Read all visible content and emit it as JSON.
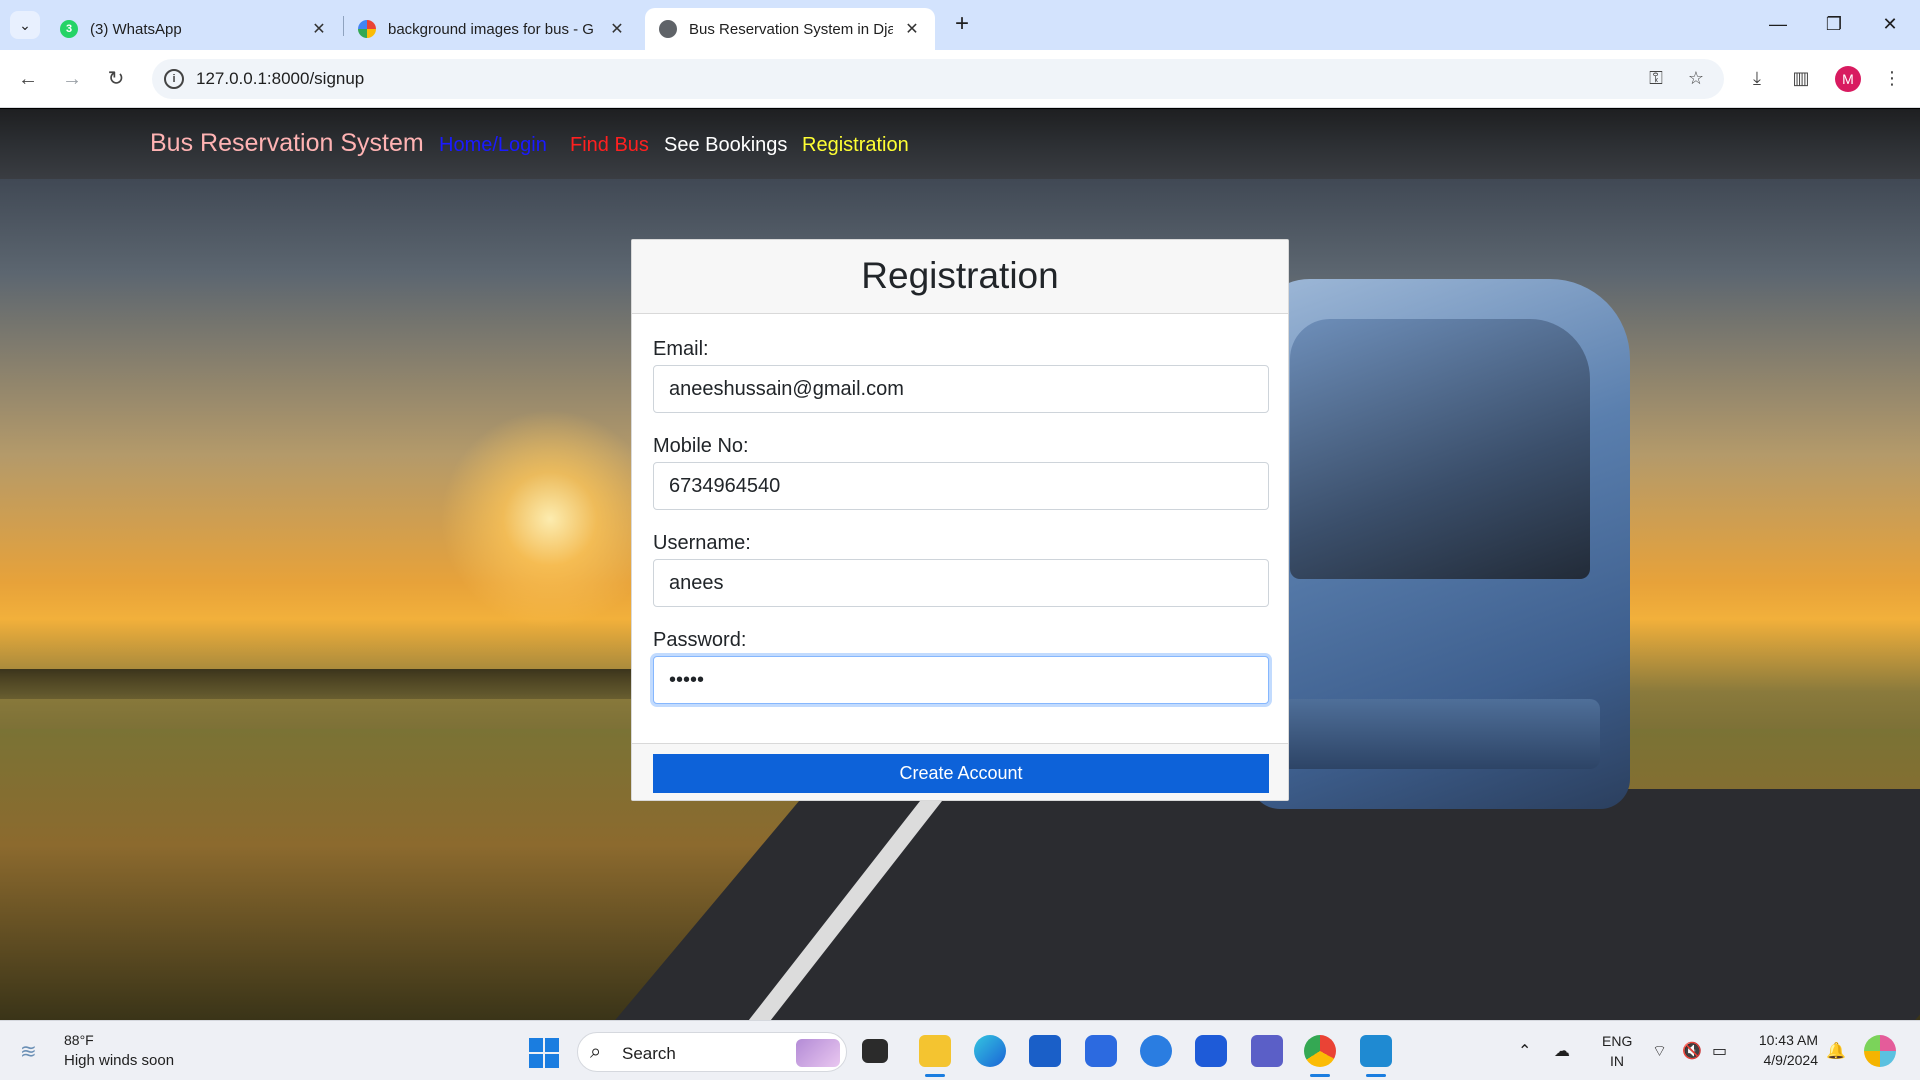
{
  "browser": {
    "tabs": [
      {
        "title": "(3) WhatsApp",
        "favicon": "whatsapp-icon",
        "badge": "3",
        "active": false
      },
      {
        "title": "background images for bus - G",
        "favicon": "google-icon",
        "active": false
      },
      {
        "title": "Bus Reservation System in Djan",
        "favicon": "globe-icon",
        "active": true
      }
    ],
    "new_tab_label": "+",
    "address": "127.0.0.1:8000/signup"
  },
  "site": {
    "brand": "Bus Reservation System",
    "nav": [
      {
        "label": "Home/Login",
        "color": "#1a1aff"
      },
      {
        "label": "Find Bus",
        "color": "#ff2020"
      },
      {
        "label": "See Bookings",
        "color": "#ffffff"
      },
      {
        "label": "Registration",
        "color": "#ffff33"
      }
    ]
  },
  "form": {
    "title": "Registration",
    "fields": [
      {
        "label": "Email:",
        "value": "aneeshussain@gmail.com"
      },
      {
        "label": "Mobile No:",
        "value": "6734964540"
      },
      {
        "label": "Username:",
        "value": "anees"
      },
      {
        "label": "Password:",
        "value": "•••••"
      }
    ],
    "submit_label": "Create Account"
  },
  "taskbar": {
    "weather_temp": "88°F",
    "weather_desc": "High winds soon",
    "search_label": "Search",
    "lang_top": "ENG",
    "lang_bottom": "IN",
    "time": "10:43 AM",
    "date": "4/9/2024"
  },
  "colors": {
    "primary_button": "#0d62d9",
    "brand_text": "#ffb3b3"
  }
}
